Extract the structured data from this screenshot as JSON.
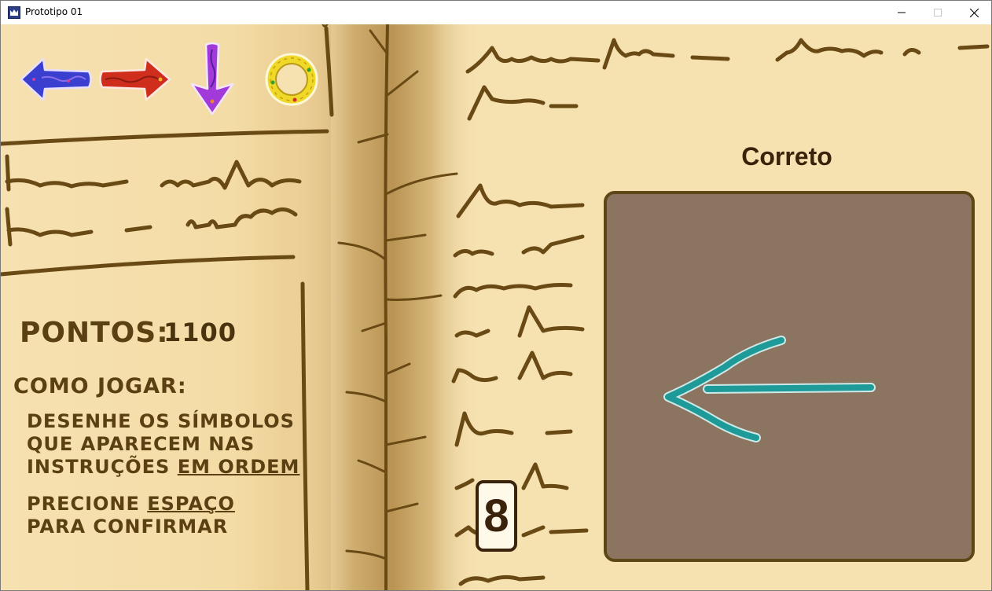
{
  "window": {
    "title": "Prototipo 01",
    "controls": [
      "minimize",
      "maximize",
      "close"
    ]
  },
  "instructions_sequence": [
    {
      "symbol": "arrow-left",
      "color": "#3b3fd0"
    },
    {
      "symbol": "arrow-right",
      "color": "#d0301e"
    },
    {
      "symbol": "arrow-down",
      "color": "#a13ad8"
    },
    {
      "symbol": "circle",
      "color": "#e8d020"
    }
  ],
  "score": {
    "label": "PONTOS:",
    "value": "1100"
  },
  "how_to_play": {
    "title": "COMO JOGAR:",
    "line1": "DESENHE OS SÍMBOLOS",
    "line2": "QUE APARECEM NAS",
    "line3": "INSTRUÇÕES",
    "line3_emphasis": "EM ORDEM",
    "line4": "PRECIONE",
    "line4_emphasis": "ESPAÇO",
    "line5": "PARA CONFIRMAR"
  },
  "feedback": {
    "status": "Correto"
  },
  "timer": {
    "value": "8"
  },
  "drawing": {
    "shape": "arrow-left",
    "stroke_color": "#1e9a98",
    "background_color": "#8b7560"
  },
  "colors": {
    "paper": "#f6e1b1",
    "ink": "#5a4012",
    "dark_ink": "#3a220b"
  }
}
